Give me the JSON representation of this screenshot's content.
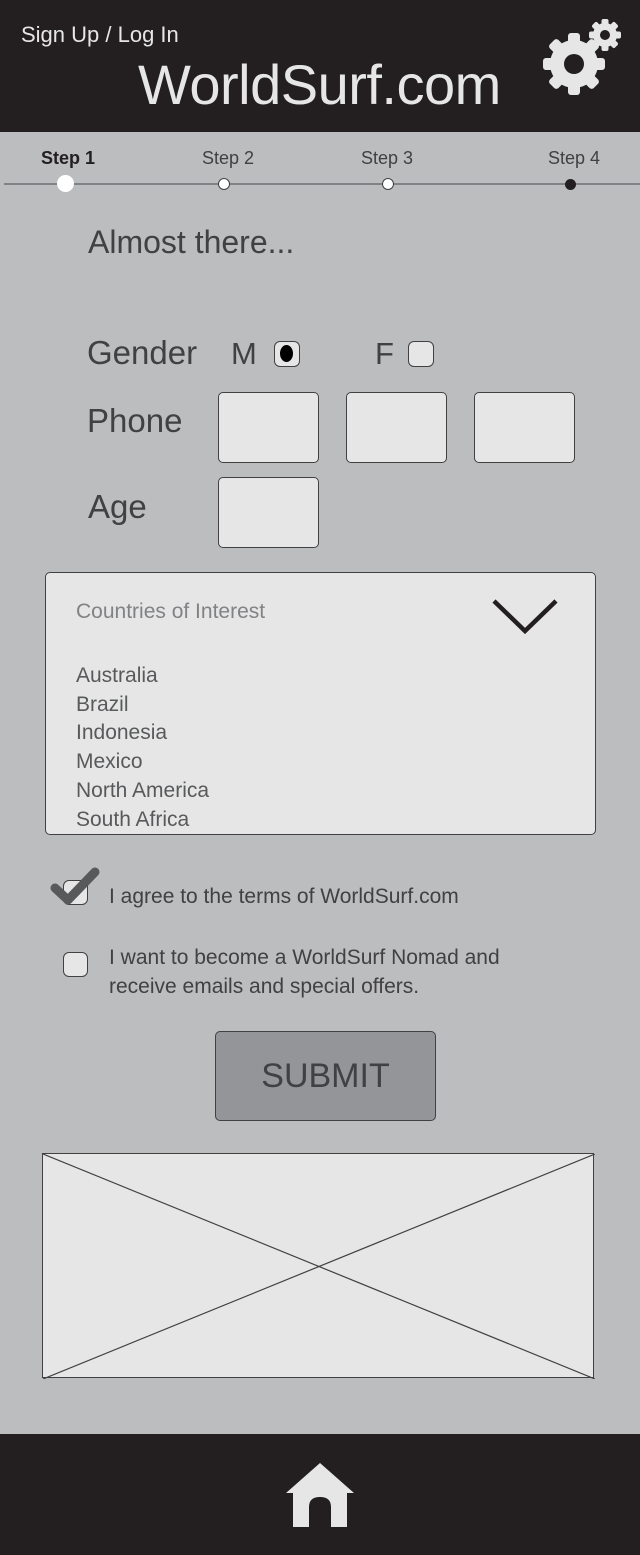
{
  "header": {
    "signup_label": "Sign Up / Log In",
    "brand": "WorldSurf.com",
    "settings_icon": "gear-icon"
  },
  "steps": [
    {
      "label": "Step 1",
      "state": "active"
    },
    {
      "label": "Step 2",
      "state": "upcoming"
    },
    {
      "label": "Step 3",
      "state": "upcoming"
    },
    {
      "label": "Step 4",
      "state": "final"
    }
  ],
  "form": {
    "title": "Almost there...",
    "gender": {
      "label": "Gender",
      "options": [
        "M",
        "F"
      ],
      "selected": "M"
    },
    "phone": {
      "label": "Phone",
      "values": [
        "",
        "",
        ""
      ]
    },
    "age": {
      "label": "Age",
      "value": ""
    },
    "countries": {
      "placeholder": "Countries  of Interest",
      "options": [
        "Australia",
        "Brazil",
        "Indonesia",
        "Mexico",
        "North America",
        "South Africa"
      ]
    },
    "terms": {
      "label": "I agree to the terms of WorldSurf.com",
      "checked": true
    },
    "nomad": {
      "label_line1": "I want to become a WorldSurf Nomad and",
      "label_line2": "receive emails and special offers.",
      "checked": false
    },
    "submit_label": "SUBMIT"
  },
  "image_placeholder": {
    "icon": "image-placeholder-icon"
  },
  "footer": {
    "home_icon": "home-icon"
  },
  "colors": {
    "header_bg": "#231f20",
    "page_bg": "#bcbdbf",
    "field_bg": "#e6e6e6",
    "text": "#414042",
    "button_bg": "#939598"
  }
}
